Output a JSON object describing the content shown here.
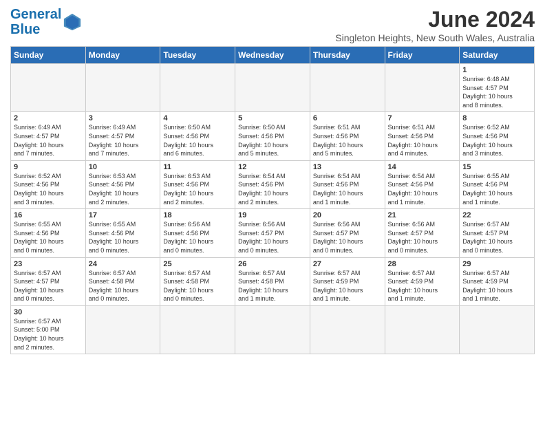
{
  "header": {
    "logo_general": "General",
    "logo_blue": "Blue",
    "month_title": "June 2024",
    "subtitle": "Singleton Heights, New South Wales, Australia"
  },
  "days_of_week": [
    "Sunday",
    "Monday",
    "Tuesday",
    "Wednesday",
    "Thursday",
    "Friday",
    "Saturday"
  ],
  "weeks": [
    [
      {
        "day": "",
        "info": ""
      },
      {
        "day": "",
        "info": ""
      },
      {
        "day": "",
        "info": ""
      },
      {
        "day": "",
        "info": ""
      },
      {
        "day": "",
        "info": ""
      },
      {
        "day": "",
        "info": ""
      },
      {
        "day": "1",
        "info": "Sunrise: 6:48 AM\nSunset: 4:57 PM\nDaylight: 10 hours\nand 8 minutes."
      }
    ],
    [
      {
        "day": "2",
        "info": "Sunrise: 6:49 AM\nSunset: 4:57 PM\nDaylight: 10 hours\nand 7 minutes."
      },
      {
        "day": "3",
        "info": "Sunrise: 6:49 AM\nSunset: 4:57 PM\nDaylight: 10 hours\nand 7 minutes."
      },
      {
        "day": "4",
        "info": "Sunrise: 6:50 AM\nSunset: 4:56 PM\nDaylight: 10 hours\nand 6 minutes."
      },
      {
        "day": "5",
        "info": "Sunrise: 6:50 AM\nSunset: 4:56 PM\nDaylight: 10 hours\nand 5 minutes."
      },
      {
        "day": "6",
        "info": "Sunrise: 6:51 AM\nSunset: 4:56 PM\nDaylight: 10 hours\nand 5 minutes."
      },
      {
        "day": "7",
        "info": "Sunrise: 6:51 AM\nSunset: 4:56 PM\nDaylight: 10 hours\nand 4 minutes."
      },
      {
        "day": "8",
        "info": "Sunrise: 6:52 AM\nSunset: 4:56 PM\nDaylight: 10 hours\nand 3 minutes."
      }
    ],
    [
      {
        "day": "9",
        "info": "Sunrise: 6:52 AM\nSunset: 4:56 PM\nDaylight: 10 hours\nand 3 minutes."
      },
      {
        "day": "10",
        "info": "Sunrise: 6:53 AM\nSunset: 4:56 PM\nDaylight: 10 hours\nand 2 minutes."
      },
      {
        "day": "11",
        "info": "Sunrise: 6:53 AM\nSunset: 4:56 PM\nDaylight: 10 hours\nand 2 minutes."
      },
      {
        "day": "12",
        "info": "Sunrise: 6:54 AM\nSunset: 4:56 PM\nDaylight: 10 hours\nand 2 minutes."
      },
      {
        "day": "13",
        "info": "Sunrise: 6:54 AM\nSunset: 4:56 PM\nDaylight: 10 hours\nand 1 minute."
      },
      {
        "day": "14",
        "info": "Sunrise: 6:54 AM\nSunset: 4:56 PM\nDaylight: 10 hours\nand 1 minute."
      },
      {
        "day": "15",
        "info": "Sunrise: 6:55 AM\nSunset: 4:56 PM\nDaylight: 10 hours\nand 1 minute."
      }
    ],
    [
      {
        "day": "16",
        "info": "Sunrise: 6:55 AM\nSunset: 4:56 PM\nDaylight: 10 hours\nand 0 minutes."
      },
      {
        "day": "17",
        "info": "Sunrise: 6:55 AM\nSunset: 4:56 PM\nDaylight: 10 hours\nand 0 minutes."
      },
      {
        "day": "18",
        "info": "Sunrise: 6:56 AM\nSunset: 4:56 PM\nDaylight: 10 hours\nand 0 minutes."
      },
      {
        "day": "19",
        "info": "Sunrise: 6:56 AM\nSunset: 4:57 PM\nDaylight: 10 hours\nand 0 minutes."
      },
      {
        "day": "20",
        "info": "Sunrise: 6:56 AM\nSunset: 4:57 PM\nDaylight: 10 hours\nand 0 minutes."
      },
      {
        "day": "21",
        "info": "Sunrise: 6:56 AM\nSunset: 4:57 PM\nDaylight: 10 hours\nand 0 minutes."
      },
      {
        "day": "22",
        "info": "Sunrise: 6:57 AM\nSunset: 4:57 PM\nDaylight: 10 hours\nand 0 minutes."
      }
    ],
    [
      {
        "day": "23",
        "info": "Sunrise: 6:57 AM\nSunset: 4:57 PM\nDaylight: 10 hours\nand 0 minutes."
      },
      {
        "day": "24",
        "info": "Sunrise: 6:57 AM\nSunset: 4:58 PM\nDaylight: 10 hours\nand 0 minutes."
      },
      {
        "day": "25",
        "info": "Sunrise: 6:57 AM\nSunset: 4:58 PM\nDaylight: 10 hours\nand 0 minutes."
      },
      {
        "day": "26",
        "info": "Sunrise: 6:57 AM\nSunset: 4:58 PM\nDaylight: 10 hours\nand 1 minute."
      },
      {
        "day": "27",
        "info": "Sunrise: 6:57 AM\nSunset: 4:59 PM\nDaylight: 10 hours\nand 1 minute."
      },
      {
        "day": "28",
        "info": "Sunrise: 6:57 AM\nSunset: 4:59 PM\nDaylight: 10 hours\nand 1 minute."
      },
      {
        "day": "29",
        "info": "Sunrise: 6:57 AM\nSunset: 4:59 PM\nDaylight: 10 hours\nand 1 minute."
      }
    ],
    [
      {
        "day": "30",
        "info": "Sunrise: 6:57 AM\nSunset: 5:00 PM\nDaylight: 10 hours\nand 2 minutes."
      },
      {
        "day": "",
        "info": ""
      },
      {
        "day": "",
        "info": ""
      },
      {
        "day": "",
        "info": ""
      },
      {
        "day": "",
        "info": ""
      },
      {
        "day": "",
        "info": ""
      },
      {
        "day": "",
        "info": ""
      }
    ]
  ]
}
